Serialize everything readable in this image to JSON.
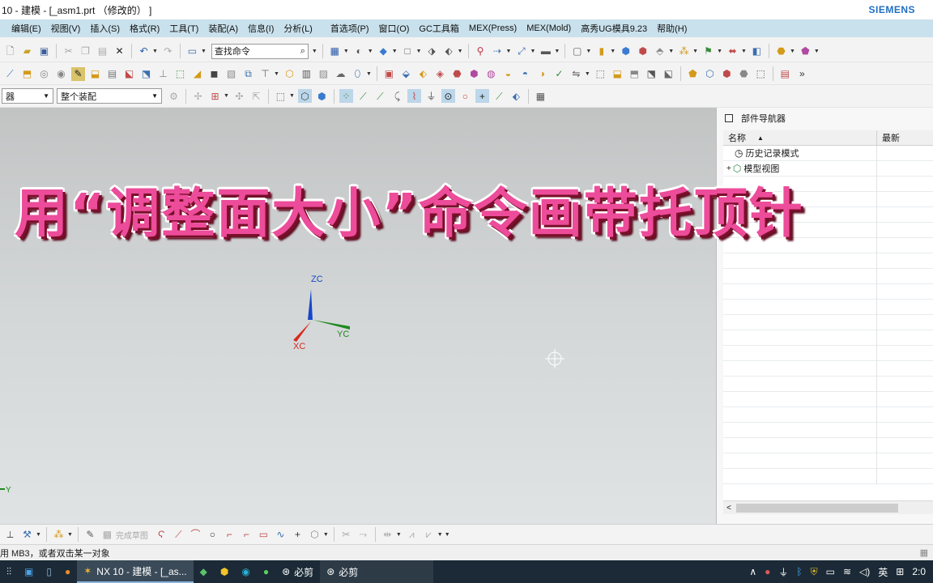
{
  "window": {
    "title": "10 - 建模 - [_asm1.prt （修改的） ]",
    "brand": "SIEMENS"
  },
  "menu": [
    "编辑(E)",
    "视图(V)",
    "插入(S)",
    "格式(R)",
    "工具(T)",
    "装配(A)",
    "信息(I)",
    "分析(L)",
    "首选项(P)",
    "窗口(O)",
    "GC工具箱",
    "MEX(Press)",
    "MEX(Mold)",
    "高秀UG模具9.23",
    "帮助(H)"
  ],
  "toolbar": {
    "command_search_placeholder": "查找命令",
    "filter_select": "器",
    "assembly_select": "整个装配"
  },
  "viewport": {
    "overlay_title": "用“调整面大小”命令画带托顶针",
    "axes": {
      "z": "ZC",
      "y": "YC",
      "x": "XC",
      "corner_y": "Y"
    }
  },
  "navigator": {
    "title": "部件导航器",
    "col_name": "名称",
    "col_latest": "最新",
    "items": [
      {
        "label": "历史记录模式"
      },
      {
        "label": "模型视图"
      }
    ],
    "scroll_left": "<"
  },
  "bottom_toolbar": {
    "finish_sketch": "完成草图"
  },
  "status": {
    "message": "用 MB3，或者双击某一对象"
  },
  "taskbar": {
    "nx_task": "NX 10 - 建模 - [_as...",
    "bijian_task_1": "必剪",
    "bijian_task_2": "必剪",
    "ime": "英",
    "clock": "2:0"
  }
}
